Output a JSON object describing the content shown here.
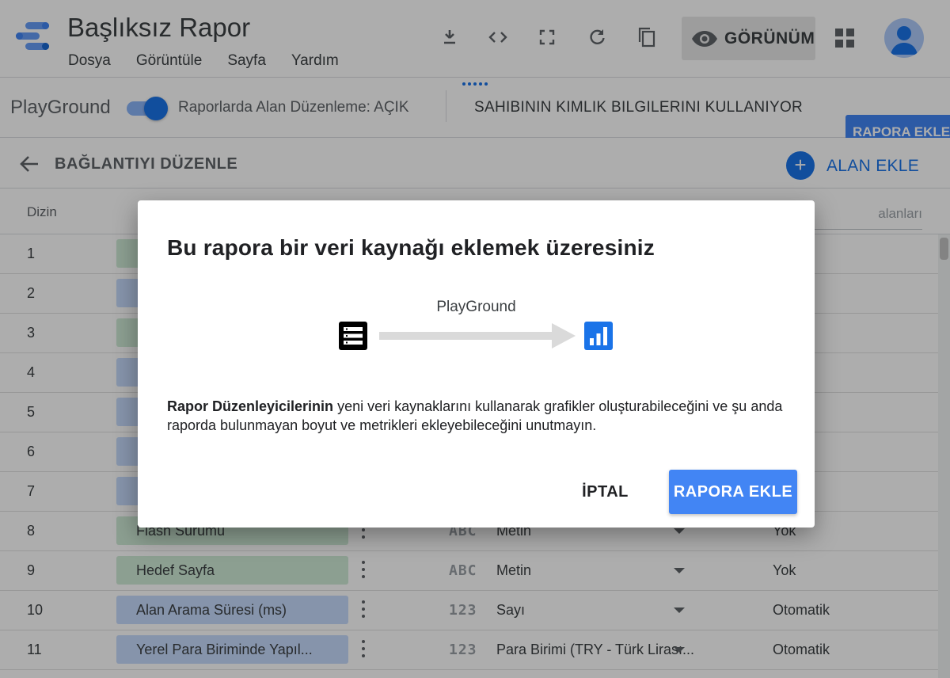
{
  "app": {
    "title": "Başlıksız Rapor",
    "menu": [
      "Dosya",
      "Görüntüle",
      "Sayfa",
      "Yardım"
    ],
    "toolbar_icons": [
      "download-icon",
      "embed-code-icon",
      "fullscreen-icon",
      "refresh-icon",
      "copy-icon"
    ],
    "view_button_label": "GÖRÜNÜM",
    "accent_color": "#1a73e8"
  },
  "connection": {
    "data_source_name": "PlayGround",
    "field_editing_label": "Raporlarda Alan Düzenleme: AÇIK",
    "field_editing_on": true,
    "credentials_label": "SAHIBININ KIMLIK BILGILERINI KULLANIYOR",
    "add_to_report_label": "RAPORA EKLE"
  },
  "edit_header": {
    "title": "BAĞLANTIYI DÜZENLE",
    "add_field_label": "ALAN EKLE"
  },
  "table": {
    "index_header": "Dizin",
    "search_placeholder": "alanları",
    "rows": [
      {
        "index": "1",
        "name": "",
        "kind": "dim",
        "type_glyph": "",
        "type": "",
        "aggregation": ""
      },
      {
        "index": "2",
        "name": "",
        "kind": "met",
        "type_glyph": "",
        "type": "",
        "aggregation": "tik"
      },
      {
        "index": "3",
        "name": "",
        "kind": "dim",
        "type_glyph": "",
        "type": "",
        "aggregation": ""
      },
      {
        "index": "4",
        "name": "",
        "kind": "met",
        "type_glyph": "",
        "type": "",
        "aggregation": "tik"
      },
      {
        "index": "5",
        "name": "",
        "kind": "met",
        "type_glyph": "",
        "type": "",
        "aggregation": "tik"
      },
      {
        "index": "6",
        "name": "",
        "kind": "met",
        "type_glyph": "",
        "type": "",
        "aggregation": "tik"
      },
      {
        "index": "7",
        "name": "",
        "kind": "met",
        "type_glyph": "",
        "type": "",
        "aggregation": "tik"
      },
      {
        "index": "8",
        "name": "Flash Sürümü",
        "kind": "dim",
        "type_glyph": "ABC",
        "type": "Metin",
        "aggregation": "Yok"
      },
      {
        "index": "9",
        "name": "Hedef Sayfa",
        "kind": "dim",
        "type_glyph": "ABC",
        "type": "Metin",
        "aggregation": "Yok"
      },
      {
        "index": "10",
        "name": "Alan Arama Süresi (ms)",
        "kind": "met",
        "type_glyph": "123",
        "type": "Sayı",
        "aggregation": "Otomatik"
      },
      {
        "index": "11",
        "name": "Yerel Para Biriminde Yapıl...",
        "kind": "met",
        "type_glyph": "123",
        "type": "Para Birimi (TRY - Türk Lirası...",
        "aggregation": "Otomatik"
      }
    ]
  },
  "dialog": {
    "title": "Bu rapora bir veri kaynağı eklemek üzeresiniz",
    "source_name": "PlayGround",
    "body_bold": "Rapor Düzenleyicilerinin",
    "body_rest": " yeni veri kaynaklarını kullanarak grafikler oluşturabileceğini ve şu anda raporda bulunmayan boyut ve metrikleri ekleyebileceğini unutmayın.",
    "cancel_label": "İPTAL",
    "confirm_label": "RAPORA EKLE",
    "confirm_color": "#4285f4"
  }
}
